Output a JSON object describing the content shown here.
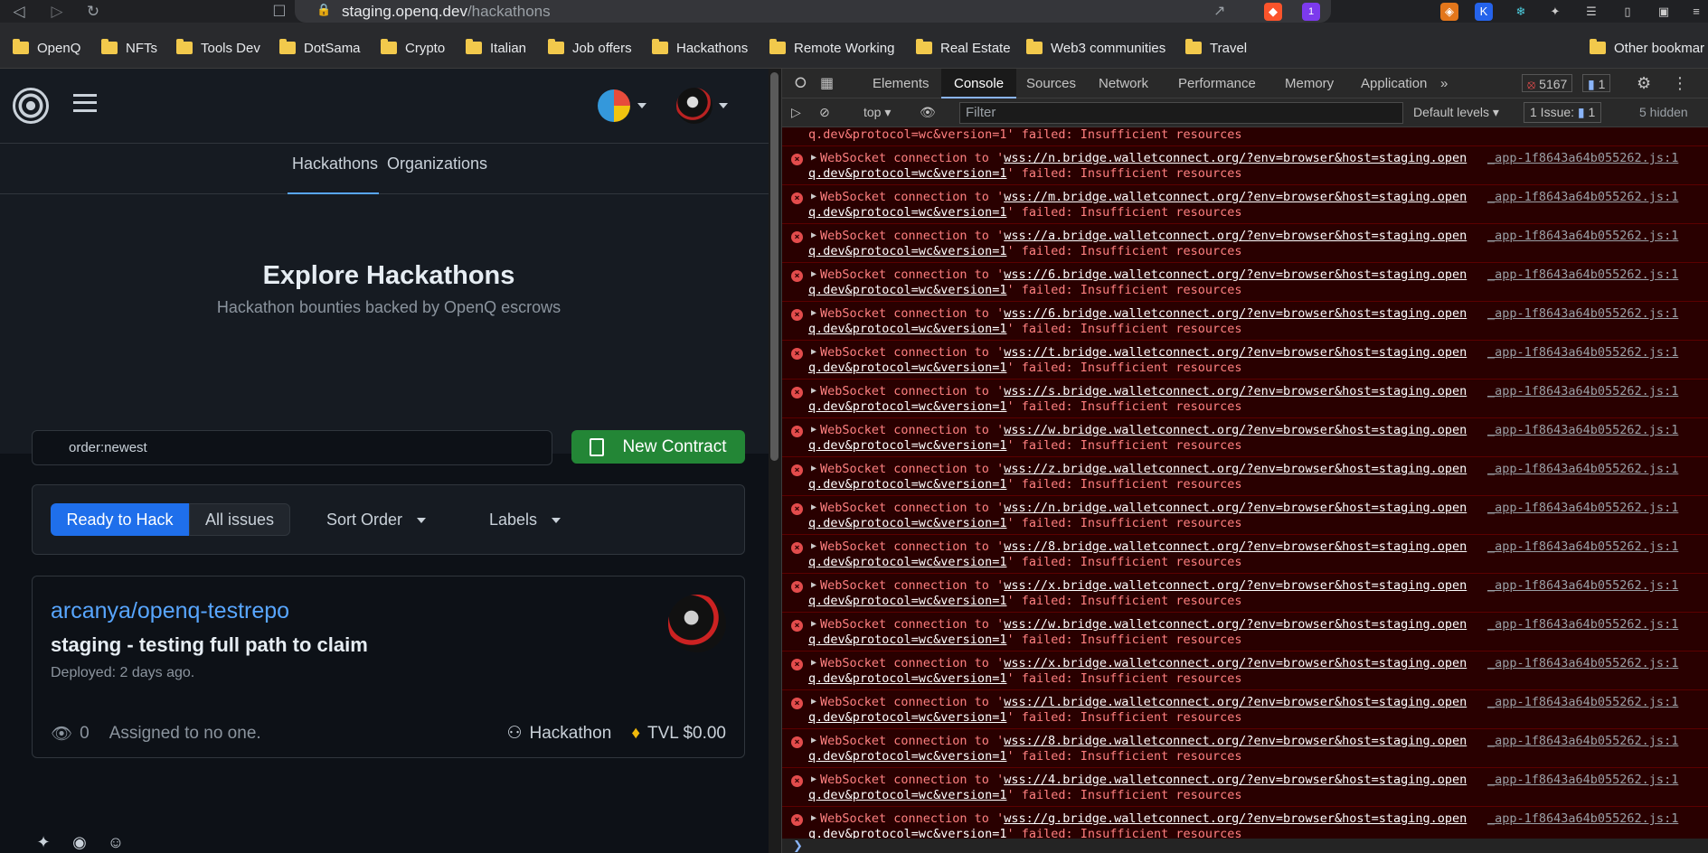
{
  "browser": {
    "url_host": "staging.openq.dev",
    "url_path": "/hackathons",
    "brave_badge": "1"
  },
  "bookmarks": [
    "OpenQ",
    "NFTs",
    "Tools Dev",
    "DotSama",
    "Crypto",
    "Italian",
    "Job offers",
    "Hackathons",
    "Remote Working",
    "Real Estate",
    "Web3 communities",
    "Travel",
    "Other bookmar"
  ],
  "app": {
    "tabs": [
      "Hackathons",
      "Organizations"
    ],
    "hero_title": "Explore Hackathons",
    "hero_subtitle": "Hackathon bounties backed by OpenQ escrows",
    "search_value": "order:newest",
    "new_contract": "New Contract",
    "filters": {
      "ready": "Ready to Hack",
      "all": "All issues",
      "sort": "Sort Order",
      "labels": "Labels"
    },
    "card": {
      "repo": "arcanya/openq-testrepo",
      "title": "staging - testing full path to claim",
      "deployed": "Deployed: 2 days ago.",
      "watchers": "0",
      "assigned": "Assigned to no one.",
      "type": "Hackathon",
      "tvl": "TVL $0.00"
    }
  },
  "devtools": {
    "tabs": [
      "Elements",
      "Console",
      "Sources",
      "Network",
      "Performance",
      "Memory",
      "Application"
    ],
    "error_count": "5167",
    "message_count": "1",
    "context": "top",
    "filter_placeholder": "Filter",
    "levels": "Default levels",
    "issues": "1 Issue:",
    "issues_count": "1",
    "hidden": "5 hidden",
    "partial_top": "q.dev&protocol=wc&version=1'  failed: Insufficient resources",
    "msg_prefix": "WebSocket connection to '",
    "msg_suffix": "'  failed: Insufficient resources",
    "source": "_app-1f8643a64b055262.js:1",
    "messages": [
      {
        "u1": "wss://n.bridge.walletconnect.org/?env=browser&host=staging.open",
        "u2": "q.dev&protocol=wc&version=1"
      },
      {
        "u1": "wss://m.bridge.walletconnect.org/?env=browser&host=staging.open",
        "u2": "q.dev&protocol=wc&version=1"
      },
      {
        "u1": "wss://a.bridge.walletconnect.org/?env=browser&host=staging.open",
        "u2": "q.dev&protocol=wc&version=1"
      },
      {
        "u1": "wss://6.bridge.walletconnect.org/?env=browser&host=staging.open",
        "u2": "q.dev&protocol=wc&version=1"
      },
      {
        "u1": "wss://6.bridge.walletconnect.org/?env=browser&host=staging.open",
        "u2": "q.dev&protocol=wc&version=1"
      },
      {
        "u1": "wss://t.bridge.walletconnect.org/?env=browser&host=staging.open",
        "u2": "q.dev&protocol=wc&version=1"
      },
      {
        "u1": "wss://s.bridge.walletconnect.org/?env=browser&host=staging.open",
        "u2": "q.dev&protocol=wc&version=1"
      },
      {
        "u1": "wss://w.bridge.walletconnect.org/?env=browser&host=staging.open",
        "u2": "q.dev&protocol=wc&version=1"
      },
      {
        "u1": "wss://z.bridge.walletconnect.org/?env=browser&host=staging.open",
        "u2": "q.dev&protocol=wc&version=1"
      },
      {
        "u1": "wss://n.bridge.walletconnect.org/?env=browser&host=staging.open",
        "u2": "q.dev&protocol=wc&version=1"
      },
      {
        "u1": "wss://8.bridge.walletconnect.org/?env=browser&host=staging.open",
        "u2": "q.dev&protocol=wc&version=1"
      },
      {
        "u1": "wss://x.bridge.walletconnect.org/?env=browser&host=staging.open",
        "u2": "q.dev&protocol=wc&version=1"
      },
      {
        "u1": "wss://w.bridge.walletconnect.org/?env=browser&host=staging.open",
        "u2": "q.dev&protocol=wc&version=1"
      },
      {
        "u1": "wss://x.bridge.walletconnect.org/?env=browser&host=staging.open",
        "u2": "q.dev&protocol=wc&version=1"
      },
      {
        "u1": "wss://l.bridge.walletconnect.org/?env=browser&host=staging.open",
        "u2": "q.dev&protocol=wc&version=1"
      },
      {
        "u1": "wss://8.bridge.walletconnect.org/?env=browser&host=staging.open",
        "u2": "q.dev&protocol=wc&version=1"
      },
      {
        "u1": "wss://4.bridge.walletconnect.org/?env=browser&host=staging.open",
        "u2": "q.dev&protocol=wc&version=1"
      },
      {
        "u1": "wss://g.bridge.walletconnect.org/?env=browser&host=staging.open",
        "u2": "q.dev&protocol=wc&version=1"
      }
    ]
  }
}
